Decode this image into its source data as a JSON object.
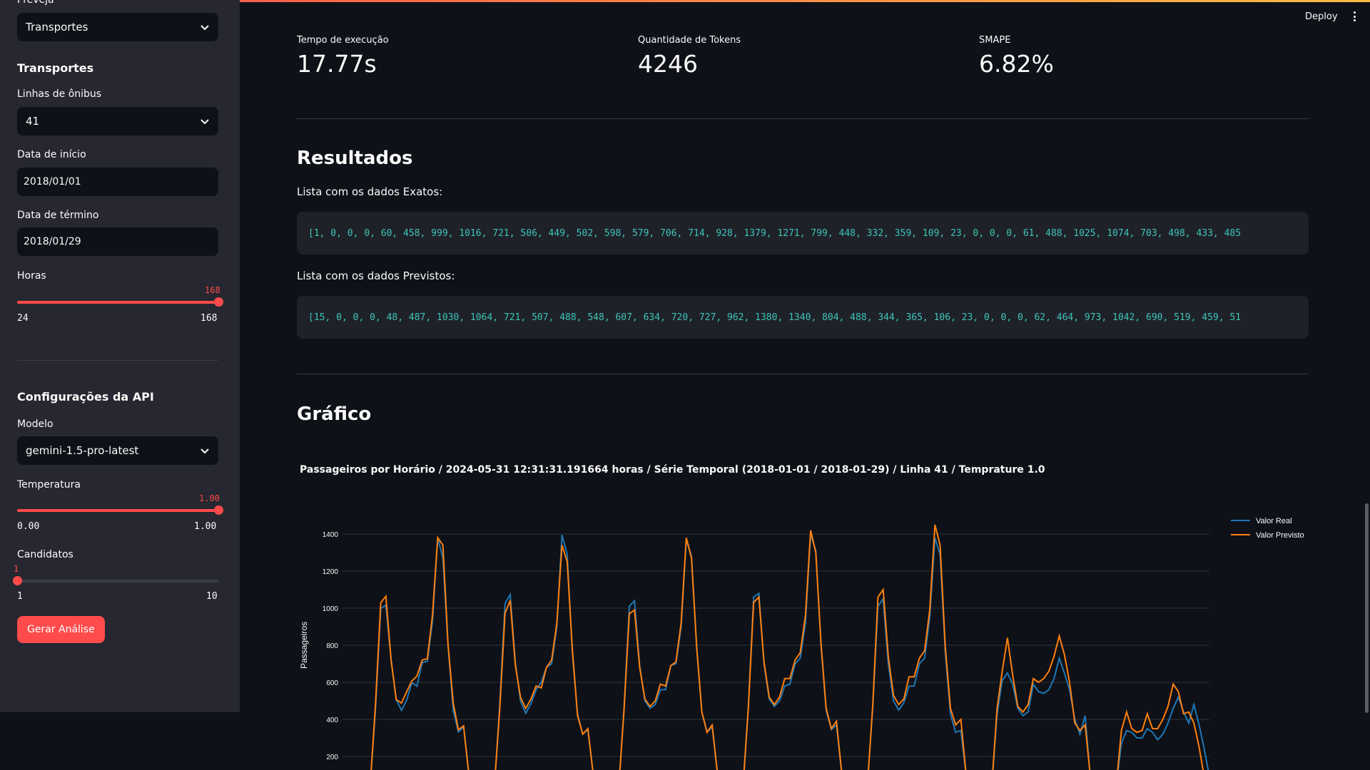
{
  "sidebar": {
    "top_label": "Preveja",
    "top_select": "Transportes",
    "section_transportes": "Transportes",
    "bus_line_label": "Linhas de ônibus",
    "bus_line_value": "41",
    "start_date_label": "Data de início",
    "start_date_value": "2018/01/01",
    "end_date_label": "Data de término",
    "end_date_value": "2018/01/29",
    "hours_label": "Horas",
    "hours_value": "168",
    "hours_min": "24",
    "hours_max": "168",
    "hours_fraction": 1.0,
    "api_section": "Configurações da API",
    "model_label": "Modelo",
    "model_value": "gemini-1.5-pro-latest",
    "temp_label": "Temperatura",
    "temp_value": "1.00",
    "temp_min": "0.00",
    "temp_max": "1.00",
    "temp_fraction": 1.0,
    "cand_label": "Candidatos",
    "cand_value": "1",
    "cand_min": "1",
    "cand_max": "10",
    "cand_fraction": 0.0,
    "generate_button": "Gerar Análise"
  },
  "header": {
    "deploy": "Deploy"
  },
  "metrics": {
    "exec_label": "Tempo de execução",
    "exec_value": "17.77s",
    "tokens_label": "Quantidade de Tokens",
    "tokens_value": "4246",
    "smape_label": "SMAPE",
    "smape_value": "6.82%"
  },
  "results": {
    "heading": "Resultados",
    "exact_label": "Lista com os dados Exatos:",
    "exact_list": "[1, 0, 0, 0, 60, 458, 999, 1016, 721, 506, 449, 502, 598, 579, 706, 714, 928, 1379, 1271, 799, 448, 332, 359, 109, 23, 0, 0, 0, 61, 488, 1025, 1074, 703, 498, 433, 485",
    "pred_label": "Lista com os dados Previstos:",
    "pred_list": "[15, 0, 0, 0, 48, 487, 1030, 1064, 721, 507, 488, 548, 607, 634, 720, 727, 962, 1380, 1340, 804, 488, 344, 365, 106, 23, 0, 0, 0, 62, 464, 973, 1042, 690, 519, 459, 51"
  },
  "graph": {
    "heading": "Gráfico"
  },
  "colors": {
    "accent": "#ff4b4b",
    "real": "#1f77b4",
    "pred": "#ff7f0e",
    "code_text": "#3dc5b6"
  },
  "chart_data": {
    "type": "line",
    "title": "Passageiros por Horário / 2024-05-31 12:31:31.191664 horas / Série Temporal (2018-01-01 / 2018-01-29) / Linha 41 / Temprature 1.0",
    "xlabel": "",
    "ylabel": "Passageiros",
    "yticks": [
      200,
      400,
      600,
      800,
      1000,
      1200,
      1400
    ],
    "ylim": [
      0,
      1480
    ],
    "legend": "top-right",
    "grid": true,
    "series": [
      {
        "name": "Valor Real",
        "color": "#1f77b4",
        "values": [
          1,
          0,
          0,
          0,
          60,
          458,
          999,
          1016,
          721,
          506,
          449,
          502,
          598,
          579,
          706,
          714,
          928,
          1379,
          1271,
          799,
          448,
          332,
          359,
          109,
          23,
          0,
          0,
          0,
          61,
          488,
          1025,
          1074,
          703,
          498,
          433,
          485,
          560,
          600,
          680,
          700,
          900,
          1395,
          1290,
          760,
          430,
          320,
          345,
          110,
          20,
          0,
          0,
          0,
          55,
          470,
          1010,
          1040,
          690,
          500,
          460,
          480,
          560,
          560,
          690,
          700,
          900,
          1370,
          1280,
          780,
          440,
          330,
          360,
          108,
          22,
          0,
          0,
          0,
          58,
          480,
          1060,
          1080,
          700,
          510,
          470,
          500,
          580,
          590,
          700,
          730,
          920,
          1400,
          1310,
          800,
          450,
          345,
          370,
          110,
          22,
          0,
          0,
          0,
          60,
          470,
          1010,
          1050,
          700,
          500,
          450,
          490,
          580,
          580,
          700,
          730,
          950,
          1380,
          1290,
          760,
          430,
          330,
          340,
          105,
          20,
          0,
          0,
          0,
          50,
          430,
          610,
          650,
          590,
          460,
          420,
          440,
          590,
          550,
          540,
          560,
          620,
          730,
          650,
          560,
          400,
          320,
          420,
          90,
          15,
          0,
          0,
          0,
          40,
          270,
          340,
          330,
          300,
          300,
          350,
          330,
          290,
          320,
          380,
          460,
          520,
          440,
          380,
          480,
          370,
          240,
          90
        ]
      },
      {
        "name": "Valor Previsto",
        "color": "#ff7f0e",
        "values": [
          15,
          0,
          0,
          0,
          48,
          487,
          1030,
          1064,
          721,
          507,
          488,
          548,
          607,
          634,
          720,
          727,
          962,
          1380,
          1340,
          804,
          488,
          344,
          365,
          106,
          23,
          0,
          0,
          0,
          62,
          464,
          973,
          1042,
          690,
          519,
          459,
          510,
          580,
          570,
          680,
          720,
          920,
          1340,
          1250,
          780,
          420,
          320,
          350,
          110,
          22,
          0,
          0,
          0,
          50,
          460,
          970,
          990,
          680,
          510,
          470,
          500,
          590,
          580,
          690,
          710,
          920,
          1380,
          1270,
          790,
          440,
          330,
          370,
          110,
          22,
          0,
          0,
          0,
          55,
          470,
          1030,
          1060,
          710,
          520,
          480,
          520,
          620,
          620,
          720,
          760,
          960,
          1420,
          1300,
          810,
          460,
          350,
          390,
          112,
          24,
          0,
          0,
          0,
          58,
          480,
          1060,
          1100,
          740,
          530,
          480,
          510,
          630,
          630,
          730,
          770,
          990,
          1450,
          1340,
          790,
          460,
          370,
          400,
          108,
          21,
          0,
          0,
          0,
          48,
          460,
          660,
          840,
          640,
          470,
          440,
          480,
          620,
          600,
          620,
          660,
          740,
          850,
          750,
          600,
          380,
          340,
          370,
          95,
          18,
          0,
          0,
          0,
          40,
          340,
          440,
          350,
          330,
          340,
          430,
          350,
          350,
          400,
          470,
          590,
          550,
          430,
          440,
          380,
          250,
          90
        ]
      }
    ]
  }
}
